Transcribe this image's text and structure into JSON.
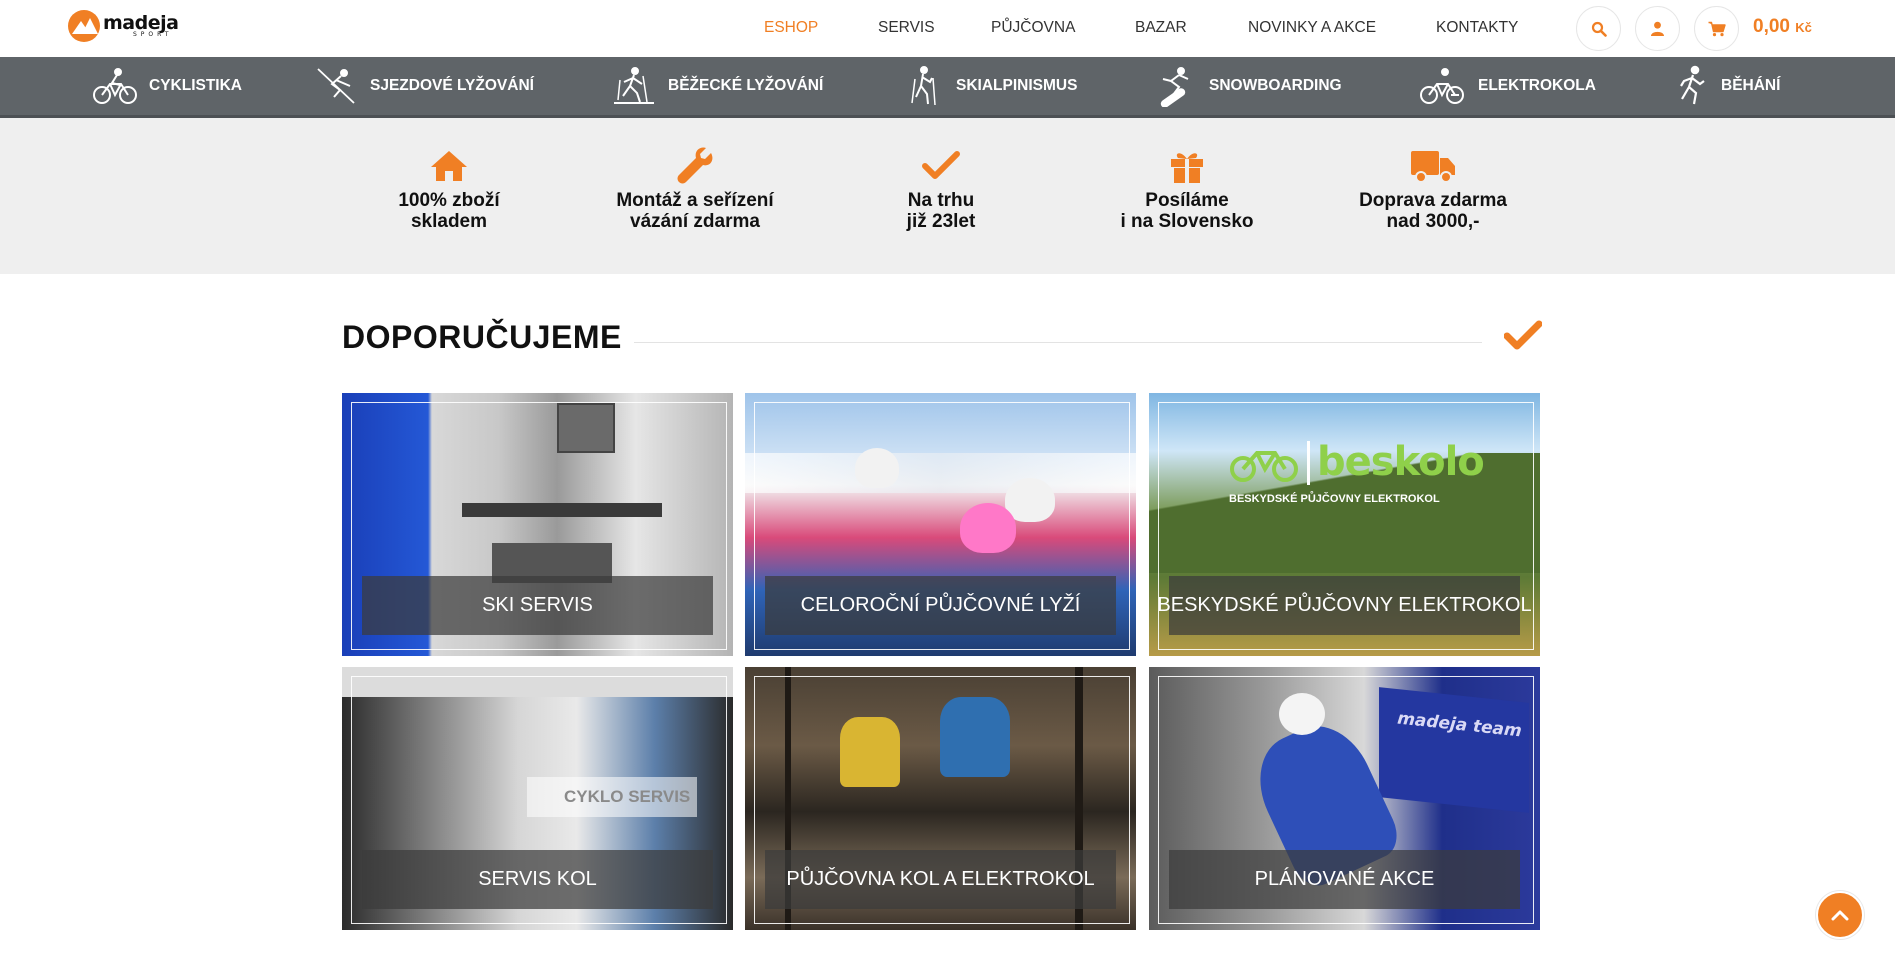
{
  "brand": {
    "logo_word": "madeja",
    "logo_sub": "SPORT",
    "accent": "#f07f24",
    "catbar_bg": "#5f6468"
  },
  "topnav": [
    {
      "label": "ESHOP",
      "active": true
    },
    {
      "label": "SERVIS"
    },
    {
      "label": "PŮJČOVNA"
    },
    {
      "label": "BAZAR"
    },
    {
      "label": "NOVINKY A AKCE"
    },
    {
      "label": "KONTAKTY"
    }
  ],
  "header_actions": {
    "search_icon": "search-icon",
    "user_icon": "user-icon",
    "cart_icon": "cart-icon",
    "cart_amount": "0,00",
    "cart_currency": "Kč"
  },
  "categories": [
    {
      "label": "CYKLISTIKA",
      "icon": "bicycle-icon"
    },
    {
      "label": "SJEZDOVÉ LYŽOVÁNÍ",
      "icon": "downhill-ski-icon"
    },
    {
      "label": "BĚŽECKÉ LYŽOVÁNÍ",
      "icon": "cross-country-ski-icon"
    },
    {
      "label": "SKIALPINISMUS",
      "icon": "ski-touring-icon"
    },
    {
      "label": "SNOWBOARDING",
      "icon": "snowboard-icon"
    },
    {
      "label": "ELEKTROKOLA",
      "icon": "ebike-icon"
    },
    {
      "label": "BĚHÁNÍ",
      "icon": "running-icon"
    }
  ],
  "features": [
    {
      "text": "100% zboží\nskladem",
      "icon": "house-icon"
    },
    {
      "text": "Montáž a seřízení\nvázání zdarma",
      "icon": "wrench-icon"
    },
    {
      "text": "Na trhu\njiž 23let",
      "icon": "check-icon"
    },
    {
      "text": "Posíláme\ni na Slovensko",
      "icon": "gift-icon"
    },
    {
      "text": "Doprava zdarma\nnad 3000,-",
      "icon": "truck-icon"
    }
  ],
  "recommend": {
    "title": "DOPORUČUJEME",
    "tiles": [
      {
        "caption": "SKI SERVIS"
      },
      {
        "caption": "CELOROČNÍ PŮJČOVNÉ LYŽÍ"
      },
      {
        "caption": "BESKYDSKÉ PŮJČOVNY ELEKTROKOL",
        "overlay_brand": "beskolo",
        "overlay_sub": "BESKYDSKÉ PŮJČOVNY ELEKTROKOL"
      },
      {
        "caption": "SERVIS KOL",
        "overlay_sign": "CYKLO SERVIS"
      },
      {
        "caption": "PŮJČOVNA KOL A ELEKTROKOL"
      },
      {
        "caption": "PLÁNOVANÉ AKCE",
        "overlay_banner": "madeja team"
      }
    ]
  },
  "scroll_top_icon": "chevron-up-icon"
}
